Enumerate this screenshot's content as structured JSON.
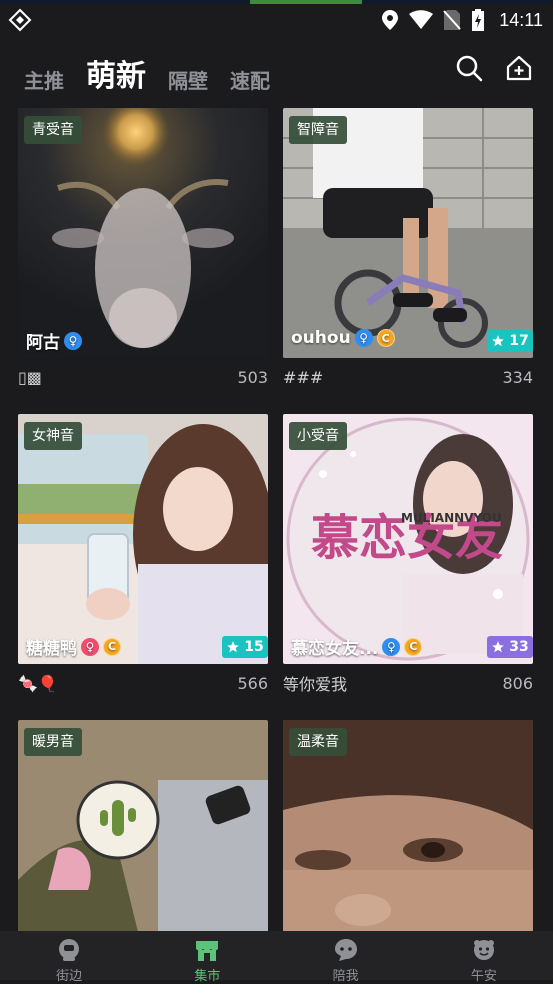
{
  "status_bar": {
    "time": "14:11",
    "icons": [
      "location-icon",
      "wifi-icon",
      "no-sim-icon",
      "battery-icon"
    ],
    "app_icon": "app-diamond-icon"
  },
  "top_tabs": [
    {
      "label": "主推",
      "active": false
    },
    {
      "label": "萌新",
      "active": true
    },
    {
      "label": "隔壁",
      "active": false
    },
    {
      "label": "速配",
      "active": false
    }
  ],
  "top_actions": {
    "search_icon": "search-icon",
    "add_icon": "add-home-icon"
  },
  "colors": {
    "background": "#1b1b1d",
    "tag_bg": "#344e38",
    "female_badge": "#f04e6e",
    "male_badge": "#2f8ef0",
    "star_teal": "#19c3c0",
    "star_purple": "#8a6fe0",
    "nav_active": "#5cc27a"
  },
  "cards": [
    {
      "tag": "青受音",
      "name": "阿古",
      "gender": "♀",
      "gender_type": "m",
      "coin": false,
      "stars": null,
      "caption": "▯▩",
      "count": "503"
    },
    {
      "tag": "智障音",
      "name": "ouhou",
      "gender": "♀",
      "gender_type": "m",
      "coin": true,
      "stars": "17",
      "caption": "###",
      "count": "334"
    },
    {
      "tag": "女神音",
      "name": "糖糖鸭",
      "gender": "♀",
      "gender_type": "f",
      "coin": true,
      "stars": "15",
      "caption": "🍬🎈",
      "count": "566"
    },
    {
      "tag": "小受音",
      "name": "慕恋女友...",
      "gender": "♀",
      "gender_type": "m",
      "coin": true,
      "stars": "33",
      "caption": "等你爱我",
      "count": "806"
    },
    {
      "tag": "暖男音",
      "name": "",
      "caption": "",
      "count": ""
    },
    {
      "tag": "温柔音",
      "name": "",
      "caption": "",
      "count": ""
    }
  ],
  "image_overlay_text": {
    "card4_title": "慕恋女友",
    "card4_sub": "MULIANNVYOU"
  },
  "bottom_nav": [
    {
      "label": "街边",
      "active": false,
      "icon": "street-icon"
    },
    {
      "label": "集市",
      "active": true,
      "icon": "market-icon"
    },
    {
      "label": "陪我",
      "active": false,
      "icon": "companion-icon"
    },
    {
      "label": "午安",
      "active": false,
      "icon": "afternoon-icon"
    }
  ]
}
